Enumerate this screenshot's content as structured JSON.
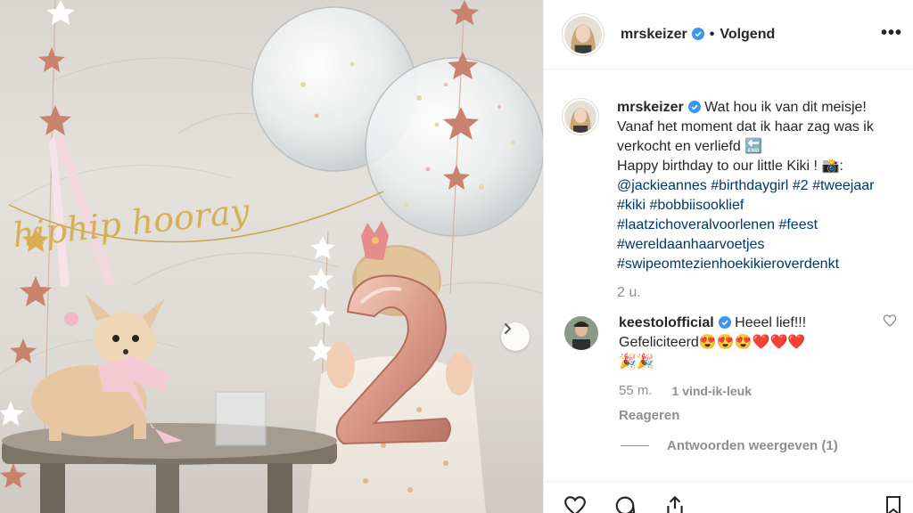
{
  "post": {
    "username": "mrskeizer",
    "follow_label": "Volgend",
    "more_label": "•••",
    "separator": "•"
  },
  "caption": {
    "username": "mrskeizer",
    "text": " Wat hou ik van dit meisje! Vanaf het moment dat ik haar zag was ik verkocht en verliefd 🔚",
    "text_line3": "Happy birthday to our little Kiki ! 📸:",
    "tags": [
      "@jackieannes",
      "#birthdaygirl",
      "#2",
      "#tweejaar",
      "#kiki",
      "#bobbiisooklief",
      "#laatzichoveralvoorlenen",
      "#feest",
      "#wereldaanhaarvoetjes",
      "#swipeomtezienhoekikieroverdenkt"
    ],
    "time": "2 u."
  },
  "comment": {
    "username": "keestolofficial",
    "text": " Heeel lief!!! Gefeliciteerd😍😍😍❤️❤️❤️",
    "text_line3": "🎉🎉",
    "time": "55 m.",
    "likes": "1 vind-ik-leuk",
    "reply_label": "Reageren",
    "view_replies_label": "Antwoorden weergeven (1)"
  },
  "photo": {
    "banner_text": "hiphip hooray"
  },
  "colors": {
    "verified": "#3897f0",
    "link": "#00376b",
    "muted": "#8e8e8e",
    "heart": "#ed4956"
  },
  "icons": {
    "like": "heart-icon",
    "comment": "comment-icon",
    "share": "share-icon",
    "save": "bookmark-icon",
    "next": "chevron-right-icon",
    "verified": "verified-badge-icon"
  }
}
